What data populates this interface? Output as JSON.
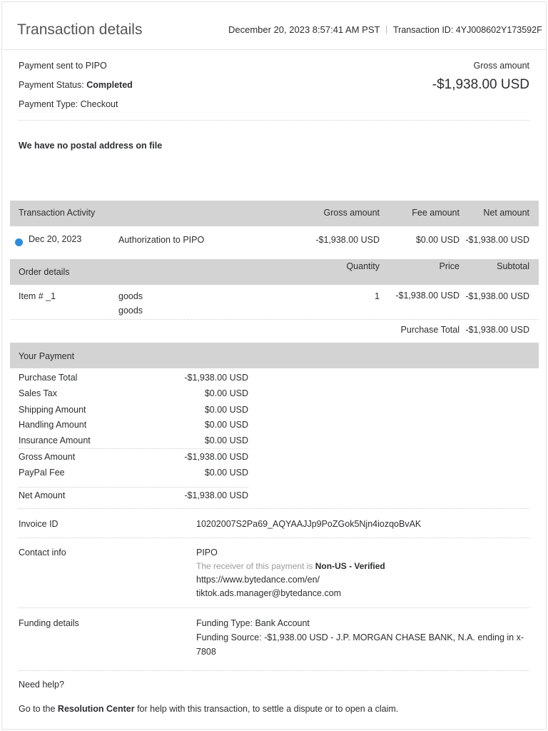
{
  "header": {
    "title": "Transaction details",
    "datetime": "December 20, 2023 8:57:41 AM PST",
    "transaction_id_label": "Transaction ID:",
    "transaction_id": "4YJ008602Y173592F"
  },
  "summary": {
    "sent_to": "Payment sent to PIPO",
    "status_label": "Payment Status:",
    "status": "Completed",
    "type_label": "Payment Type:",
    "type": "Checkout",
    "gross_label": "Gross amount",
    "gross_value": "-$1,938.00 USD"
  },
  "address_note": "We have no postal address on file",
  "activity": {
    "headers": [
      "Transaction Activity",
      "Gross amount",
      "Fee amount",
      "Net amount"
    ],
    "row": {
      "date": "Dec 20, 2023",
      "description": "Authorization to PIPO",
      "gross": "-$1,938.00 USD",
      "fee": "$0.00 USD",
      "net": "-$1,938.00 USD"
    },
    "dot_color": "#2a8de0"
  },
  "order": {
    "headers": [
      "Order details",
      "Quantity",
      "Price",
      "Subtotal"
    ],
    "item": {
      "name": "Item # _1",
      "desc1": "goods",
      "desc2": "goods",
      "quantity": "1",
      "price": "-$1,938.00  USD",
      "subtotal": "-$1,938.00 USD"
    },
    "purchase_total_label": "Purchase Total",
    "purchase_total": "-$1,938.00 USD"
  },
  "payment": {
    "title": "Your Payment",
    "rows": [
      {
        "label": "Purchase Total",
        "value": "-$1,938.00 USD"
      },
      {
        "label": "Sales Tax",
        "value": "$0.00 USD"
      },
      {
        "label": "Shipping Amount",
        "value": "$0.00 USD"
      },
      {
        "label": "Handling Amount",
        "value": "$0.00 USD"
      },
      {
        "label": "Insurance Amount",
        "value": "$0.00 USD"
      },
      {
        "label": "Gross Amount",
        "value": "-$1,938.00 USD"
      },
      {
        "label": "PayPal Fee",
        "value": "$0.00 USD"
      },
      {
        "label": "Net Amount",
        "value": "-$1,938.00 USD"
      }
    ]
  },
  "invoice": {
    "label": "Invoice ID",
    "value": "10202007S2Pa69_AQYAAJJp9PoZGok5Njn4iozqoBvAK"
  },
  "contact": {
    "label": "Contact info",
    "name": "PIPO",
    "receiver_prefix": "The receiver of this payment is",
    "receiver_status": "Non-US - Verified",
    "website": "https://www.bytedance.com/en/",
    "email": "tiktok.ads.manager@bytedance.com"
  },
  "funding": {
    "label": "Funding details",
    "type": "Funding Type: Bank Account",
    "source": "Funding Source: -$1,938.00  USD - J.P. MORGAN CHASE BANK, N.A. ending in x-",
    "source_cont": "7808"
  },
  "help": {
    "title": "Need help?",
    "prefix": "Go to the",
    "link": "Resolution Center",
    "suffix": "for help with this transaction, to settle a dispute or to open a claim."
  }
}
